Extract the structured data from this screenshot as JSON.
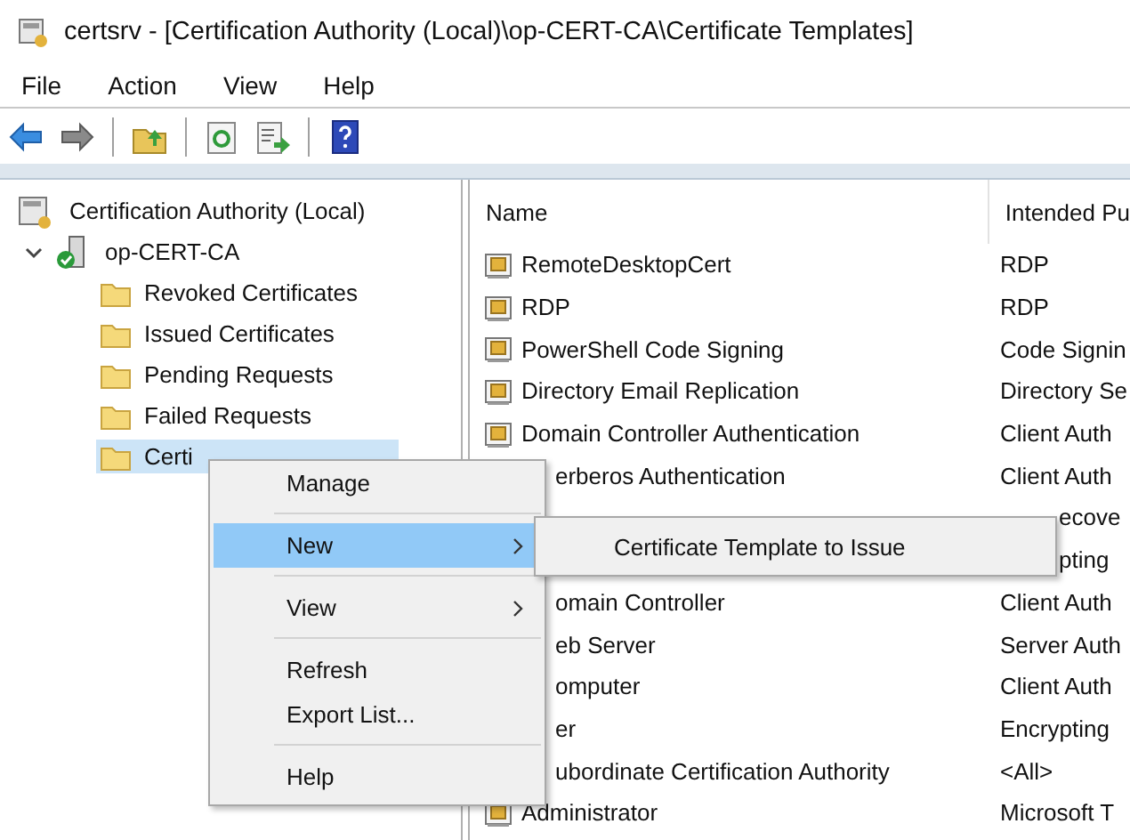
{
  "window": {
    "title": "certsrv - [Certification Authority (Local)\\op-CERT-CA\\Certificate Templates]"
  },
  "menu_bar": [
    "File",
    "Action",
    "View",
    "Help"
  ],
  "tree": {
    "label": "Certification Authority (Local)",
    "children": [
      {
        "label": "op-CERT-CA",
        "expanded": true,
        "children": [
          {
            "label": "Revoked Certificates",
            "selected": false
          },
          {
            "label": "Issued Certificates",
            "selected": false
          },
          {
            "label": "Pending Requests",
            "selected": false
          },
          {
            "label": "Failed Requests",
            "selected": false
          },
          {
            "label": "Certi",
            "selected": true
          }
        ]
      }
    ]
  },
  "list": {
    "columns": [
      "Name",
      "Intended Pu"
    ],
    "rows": [
      {
        "kind": "full",
        "name": "RemoteDesktopCert",
        "purpose": "RDP"
      },
      {
        "kind": "full",
        "name": "RDP",
        "purpose": "RDP"
      },
      {
        "kind": "full",
        "name": "PowerShell Code Signing",
        "purpose": "Code Signin"
      },
      {
        "kind": "full",
        "name": "Directory Email Replication",
        "purpose": "Directory Se"
      },
      {
        "kind": "full",
        "name": "Domain Controller Authentication",
        "purpose": "Client Auth"
      },
      {
        "kind": "under-menu",
        "name": "erberos Authentication",
        "purpose": "Client Auth"
      },
      {
        "kind": "under-submenu",
        "purpose": "ecove"
      },
      {
        "kind": "under-submenu",
        "purpose": "pting"
      },
      {
        "kind": "under-menu",
        "name": "omain Controller",
        "purpose": "Client Auth"
      },
      {
        "kind": "under-menu",
        "name": "eb Server",
        "purpose": "Server Auth"
      },
      {
        "kind": "under-menu",
        "name": "omputer",
        "purpose": "Client Auth"
      },
      {
        "kind": "under-menu",
        "name": "er",
        "purpose": "Encrypting"
      },
      {
        "kind": "under-menu",
        "name": "ubordinate Certification Authority",
        "purpose": "<All>"
      },
      {
        "kind": "full",
        "name": "Administrator",
        "purpose": "Microsoft T"
      }
    ]
  },
  "context_menu": {
    "items": [
      {
        "kind": "item",
        "label": "Manage",
        "submenu": false,
        "selected": false
      },
      {
        "kind": "separator"
      },
      {
        "kind": "item",
        "label": "New",
        "submenu": true,
        "selected": true
      },
      {
        "kind": "separator"
      },
      {
        "kind": "item",
        "label": "View",
        "submenu": true,
        "selected": false
      },
      {
        "kind": "separator"
      },
      {
        "kind": "item",
        "label": "Refresh",
        "submenu": false,
        "selected": false
      },
      {
        "kind": "item",
        "label": "Export List...",
        "submenu": false,
        "selected": false
      },
      {
        "kind": "separator"
      },
      {
        "kind": "item",
        "label": "Help",
        "submenu": false,
        "selected": false
      }
    ],
    "submenu": [
      "Certificate Template to Issue"
    ]
  }
}
